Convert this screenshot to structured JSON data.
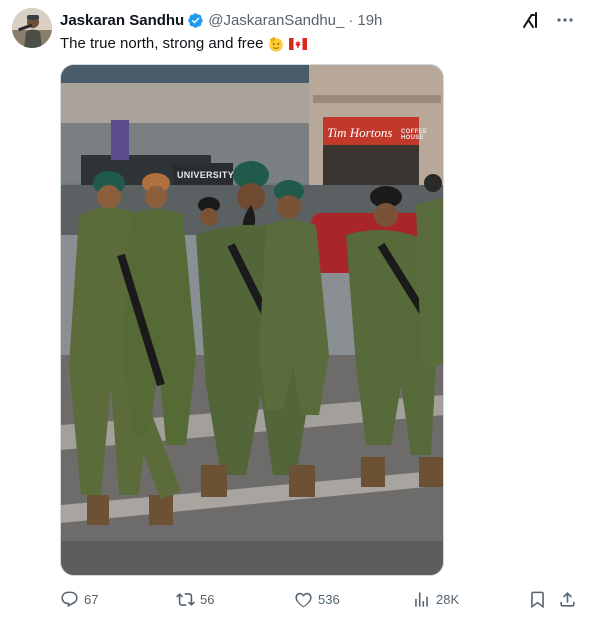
{
  "tweet": {
    "display_name": "Jaskaran Sandhu",
    "handle": "@JaskaranSandhu_",
    "separator": "·",
    "time": "19h",
    "text": "The true north, strong and free",
    "verified": true,
    "emojis": [
      "saluting-face",
      "canada-flag"
    ]
  },
  "media": {
    "storefront_sign": "Tim Hortons",
    "storefront_sub": "COFFEE HOUSE",
    "building_sign": "UNIVERSITY"
  },
  "actions": {
    "replies": "67",
    "reposts": "56",
    "likes": "536",
    "views": "28K"
  },
  "colors": {
    "text_primary": "#0f1419",
    "text_secondary": "#536471",
    "verified_blue": "#1d9bf0",
    "border": "#cfd9de"
  }
}
